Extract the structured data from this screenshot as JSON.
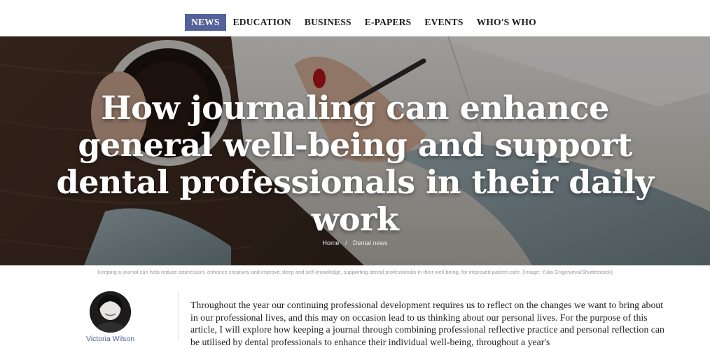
{
  "nav": {
    "items": [
      {
        "label": "NEWS",
        "active": true
      },
      {
        "label": "EDUCATION",
        "active": false
      },
      {
        "label": "BUSINESS",
        "active": false
      },
      {
        "label": "E-PAPERS",
        "active": false
      },
      {
        "label": "EVENTS",
        "active": false
      },
      {
        "label": "WHO'S WHO",
        "active": false
      }
    ],
    "active_color": "#54619a"
  },
  "hero": {
    "title": "How journaling can enhance general well-being and support dental professionals in their daily work",
    "breadcrumb": {
      "home": "Home",
      "separator": "/",
      "section": "Dental news"
    }
  },
  "caption": "Keeping a journal can help reduce depression, enhance creativity and improve sleep and self-knowledge, supporting dental professionals in their well-being, for improved patient care. (Image: Yulia Grigoryeva/Shutterstock)",
  "author": {
    "name": "Victoria Wilson"
  },
  "article": {
    "intro": "Throughout the year our continuing professional development requires us to reflect on the changes we want to bring about in our professional lives, and this may on occasion lead to us thinking about our personal lives. For the purpose of this article, I will explore how keeping a journal through combining professional reflective practice and personal reflection can be utilised by dental professionals to enhance their individual well-being, throughout a year's"
  }
}
